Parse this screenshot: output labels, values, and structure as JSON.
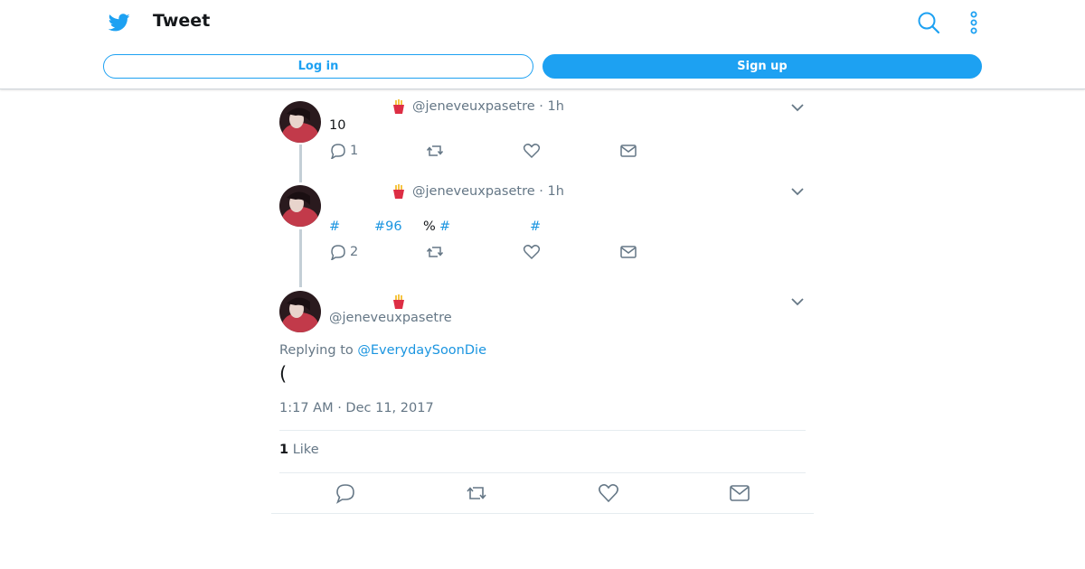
{
  "header": {
    "title": "Tweet",
    "login_label": "Log in",
    "signup_label": "Sign up",
    "icons": [
      "twitter-bird-icon",
      "search-icon",
      "more-vertical-icon"
    ]
  },
  "colors": {
    "brand": "#1da1f2",
    "link": "#1b95e0",
    "muted": "#657786",
    "thread_line": "#c4cfd6"
  },
  "tweets": [
    {
      "handle": "@jeneveuxpasetre",
      "time": "· 1h",
      "text": "10",
      "reply_count": "1"
    },
    {
      "handle": "@jeneveuxpasetre",
      "time": "· 1h",
      "hashtags": [
        "#",
        "#96",
        "#",
        "#"
      ],
      "plain": "%",
      "reply_count": "2"
    }
  ],
  "main_tweet": {
    "handle": "@jeneveuxpasetre",
    "replying_prefix": "Replying to",
    "replying_to": "@EverydaySoonDie",
    "text": "(",
    "timestamp": "1:17 AM · Dec 11, 2017",
    "like_count": "1",
    "like_label": "Like"
  }
}
